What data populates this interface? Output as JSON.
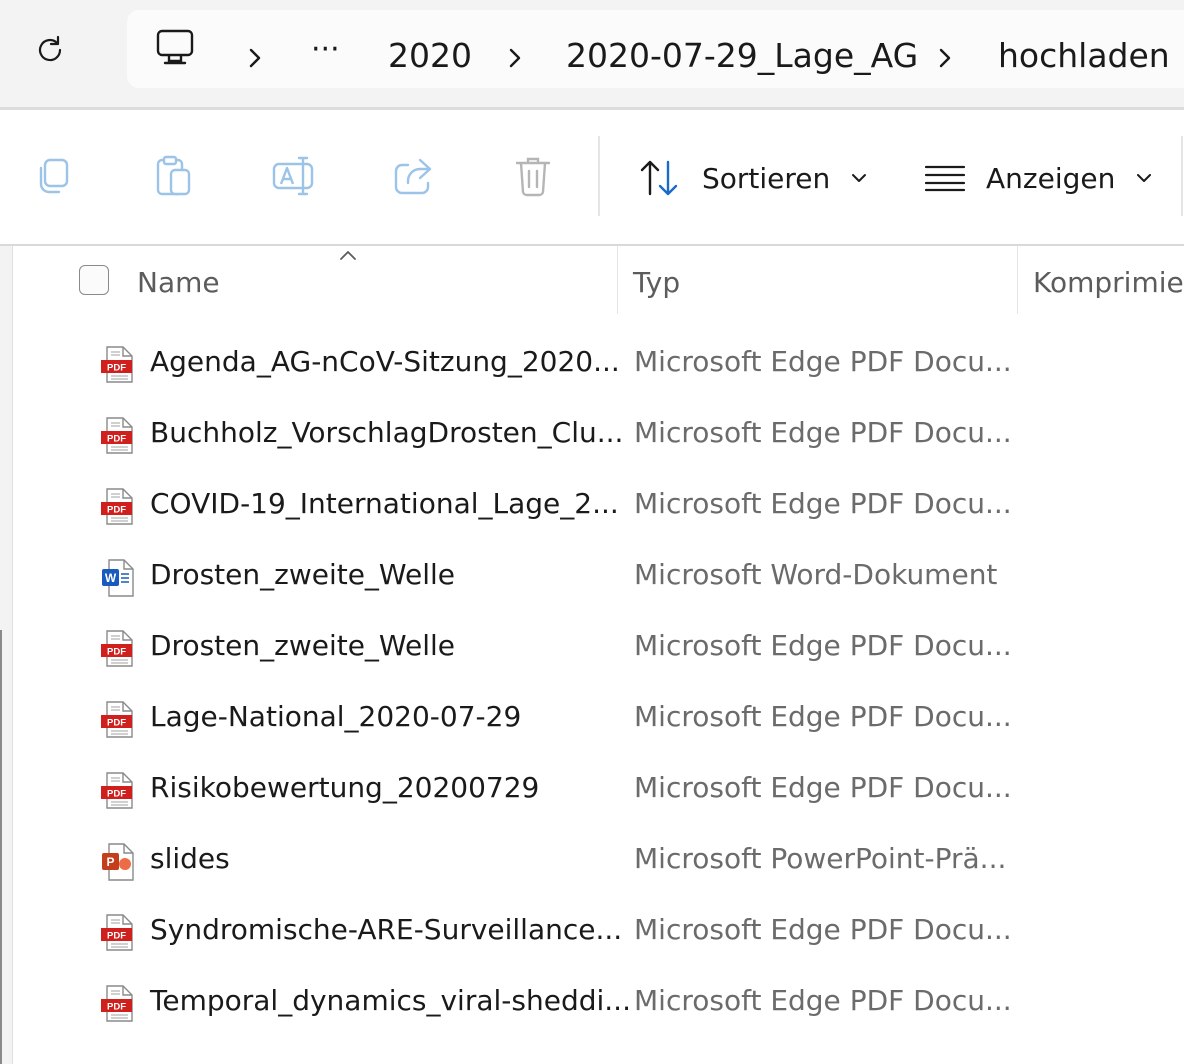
{
  "breadcrumb": {
    "overflow": "···",
    "items": [
      "2020",
      "2020-07-29_Lage_AG",
      "hochladen"
    ]
  },
  "toolbar": {
    "sort_label": "Sortieren",
    "view_label": "Anzeigen"
  },
  "columns": {
    "name": "Name",
    "type": "Typ",
    "compressed": "Komprimier"
  },
  "files": [
    {
      "name": "Agenda_AG-nCoV-Sitzung_2020...",
      "type": "Microsoft Edge PDF Docu...",
      "icon": "pdf"
    },
    {
      "name": "Buchholz_VorschlagDrosten_Clu...",
      "type": "Microsoft Edge PDF Docu...",
      "icon": "pdf"
    },
    {
      "name": "COVID-19_International_Lage_2...",
      "type": "Microsoft Edge PDF Docu...",
      "icon": "pdf"
    },
    {
      "name": "Drosten_zweite_Welle",
      "type": "Microsoft Word-Dokument",
      "icon": "word"
    },
    {
      "name": "Drosten_zweite_Welle",
      "type": "Microsoft Edge PDF Docu...",
      "icon": "pdf"
    },
    {
      "name": "Lage-National_2020-07-29",
      "type": "Microsoft Edge PDF Docu...",
      "icon": "pdf"
    },
    {
      "name": "Risikobewertung_20200729",
      "type": "Microsoft Edge PDF Docu...",
      "icon": "pdf"
    },
    {
      "name": "slides",
      "type": "Microsoft PowerPoint-Prä...",
      "icon": "powerpoint"
    },
    {
      "name": "Syndromische-ARE-Surveillance...",
      "type": "Microsoft Edge PDF Docu...",
      "icon": "pdf"
    },
    {
      "name": "Temporal_dynamics_viral-sheddi...",
      "type": "Microsoft Edge PDF Docu...",
      "icon": "pdf"
    }
  ],
  "icons": {
    "pdf_badge": "PDF",
    "word_badge": "W",
    "ppt_badge": "P"
  },
  "colors": {
    "pdf_red": "#d0201e",
    "word_blue": "#185abd",
    "ppt_orange": "#c43e1c",
    "disabled_icon_blue": "#9cc4e8"
  }
}
